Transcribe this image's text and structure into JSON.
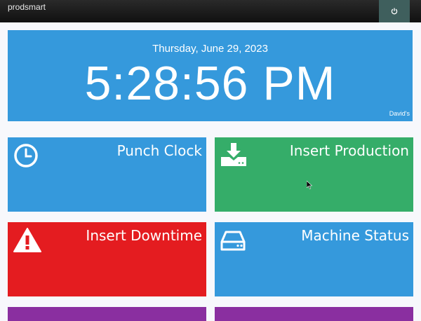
{
  "app": {
    "title": "prodsmart"
  },
  "header": {
    "power_icon": "power-icon"
  },
  "clock": {
    "date": "Thursday, June 29, 2023",
    "time": "5:28:56 PM",
    "owner": "David's"
  },
  "tiles": [
    {
      "label": "Punch Clock",
      "icon": "clock-icon",
      "color": "#3599dc"
    },
    {
      "label": "Insert Production",
      "icon": "download-drive-icon",
      "color": "#35ad69"
    },
    {
      "label": "Insert Downtime",
      "icon": "warning-icon",
      "color": "#e41c20"
    },
    {
      "label": "Machine Status",
      "icon": "hard-drive-icon",
      "color": "#3599dc"
    }
  ]
}
